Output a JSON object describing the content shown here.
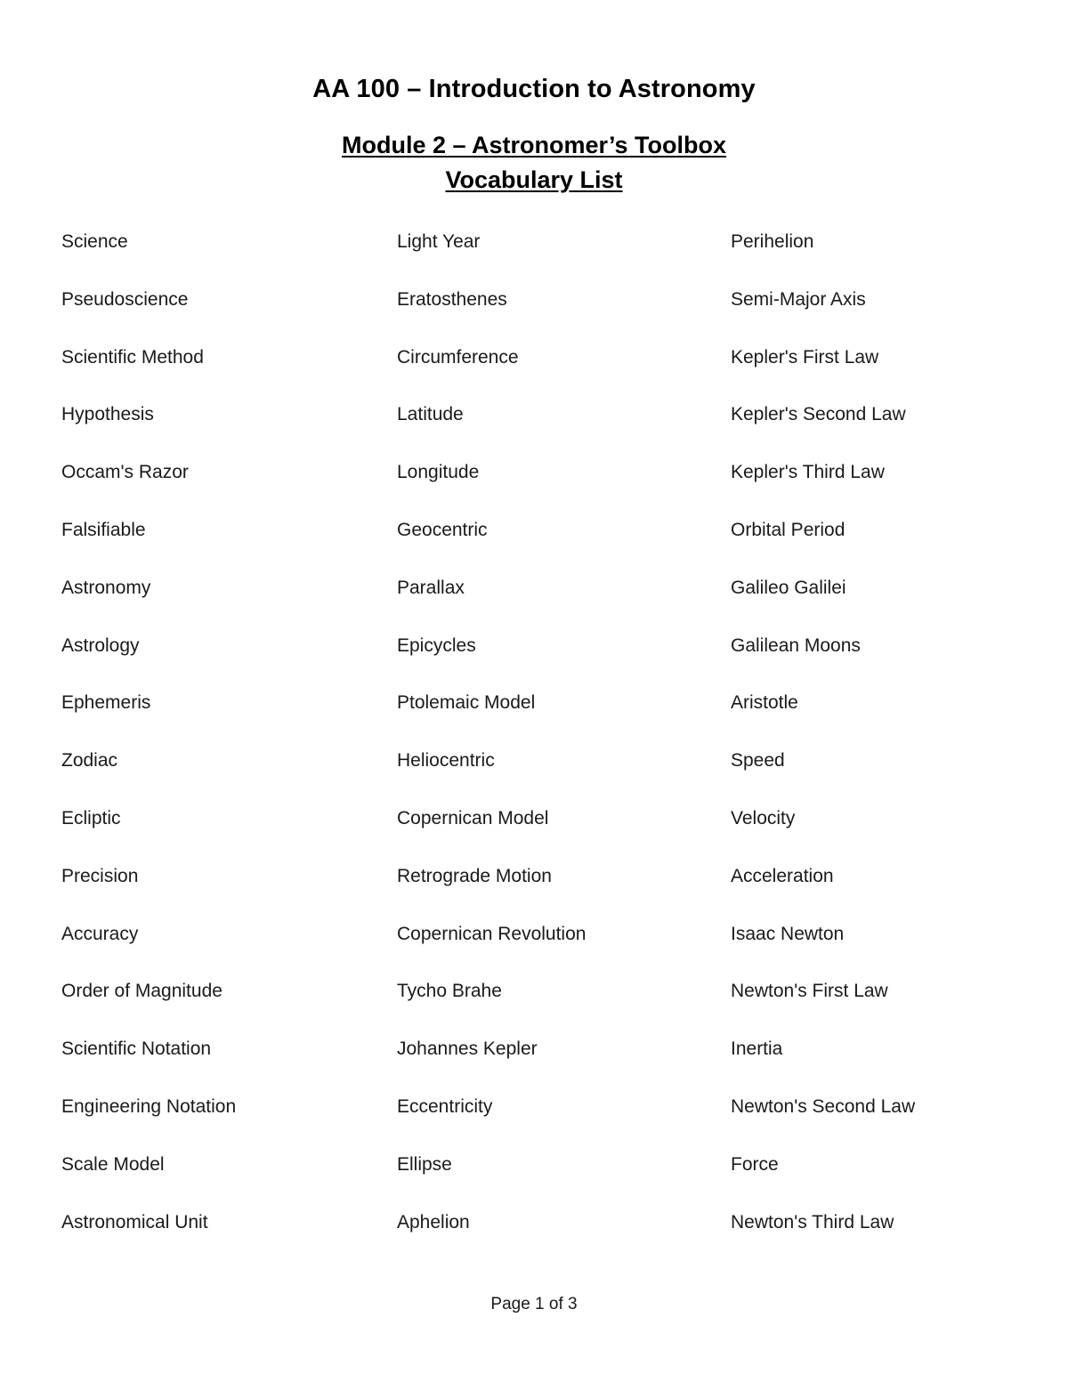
{
  "document": {
    "title": "AA 100 – Introduction to Astronomy",
    "subtitle_line_1": "Module 2 – Astronomer’s Toolbox",
    "subtitle_line_2": "Vocabulary List",
    "footer": "Page 1 of 3"
  },
  "vocabulary": {
    "column_1": [
      "Science",
      "Pseudoscience",
      "Scientific Method",
      "Hypothesis",
      "Occam's Razor",
      "Falsifiable",
      "Astronomy",
      "Astrology",
      "Ephemeris",
      "Zodiac",
      "Ecliptic",
      "Precision",
      "Accuracy",
      "Order of Magnitude",
      "Scientific Notation",
      "Engineering Notation",
      "Scale Model",
      "Astronomical Unit"
    ],
    "column_2": [
      "Light Year",
      "Eratosthenes",
      "Circumference",
      "Latitude",
      "Longitude",
      "Geocentric",
      "Parallax",
      "Epicycles",
      "Ptolemaic Model",
      "Heliocentric",
      "Copernican Model",
      "Retrograde Motion",
      "Copernican Revolution",
      "Tycho Brahe",
      "Johannes Kepler",
      "Eccentricity",
      "Ellipse",
      "Aphelion"
    ],
    "column_3": [
      "Perihelion",
      "Semi-Major Axis",
      "Kepler's First Law",
      "Kepler's Second Law",
      "Kepler's Third Law",
      "Orbital Period",
      "Galileo Galilei",
      "Galilean Moons",
      "Aristotle",
      "Speed",
      "Velocity",
      "Acceleration",
      "Isaac Newton",
      "Newton's First Law",
      "Inertia",
      "Newton's Second Law",
      "Force",
      "Newton's Third Law"
    ]
  }
}
